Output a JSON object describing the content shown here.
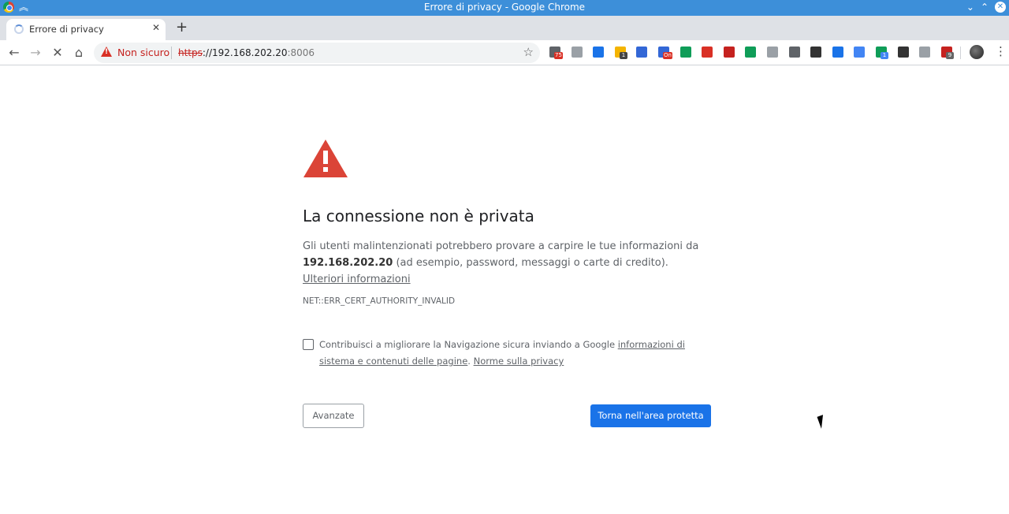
{
  "window": {
    "title": "Errore di privacy - Google Chrome"
  },
  "tabs": [
    {
      "label": "Errore di privacy"
    }
  ],
  "omnibox": {
    "security_label": "Non sicuro",
    "url_scheme": "https",
    "url_separator": "://",
    "url_host": "192.168.202.20",
    "url_port": ":8006"
  },
  "extensions": [
    {
      "name": "calendar-ext-icon",
      "color": "#5f6368",
      "badge": "75",
      "badge_color": "#d93025"
    },
    {
      "name": "globe-ext-icon",
      "color": "#9aa0a6"
    },
    {
      "name": "window-ext-icon",
      "color": "#1a73e8"
    },
    {
      "name": "note-ext-icon",
      "color": "#f4b400",
      "badge": "1",
      "badge_color": "#444444"
    },
    {
      "name": "list-ext-icon",
      "color": "#3367d6"
    },
    {
      "name": "table-ext-icon",
      "color": "#3367d6",
      "badge": "On",
      "badge_color": "#d93025"
    },
    {
      "name": "map-ext-icon",
      "color": "#0f9d58"
    },
    {
      "name": "opera-ext-icon",
      "color": "#d93025"
    },
    {
      "name": "forward-ext-icon",
      "color": "#c5221f"
    },
    {
      "name": "arrow-ext-icon",
      "color": "#0f9d58"
    },
    {
      "name": "play-ext-icon",
      "color": "#9aa0a6"
    },
    {
      "name": "s-ext-icon",
      "color": "#5f6368"
    },
    {
      "name": "camera-ext-icon",
      "color": "#333333"
    },
    {
      "name": "expand-ext-icon",
      "color": "#1a73e8"
    },
    {
      "name": "translate-ext-icon",
      "color": "#4285f4"
    },
    {
      "name": "circle-ext-icon",
      "color": "#0f9d58",
      "badge": "1",
      "badge_color": "#4285f4"
    },
    {
      "name": "scatter-ext-icon",
      "color": "#333333"
    },
    {
      "name": "radiation-ext-icon",
      "color": "#9aa0a6"
    },
    {
      "name": "r-ext-icon",
      "color": "#c5221f",
      "badge": "9",
      "badge_color": "#666666"
    }
  ],
  "page": {
    "heading": "La connessione non è privata",
    "desc_part1": "Gli utenti malintenzionati potrebbero provare a carpire le tue informazioni da ",
    "desc_host": "192.168.202.20",
    "desc_part2": " (ad esempio, password, messaggi o carte di credito). ",
    "desc_link": "Ulteriori informazioni",
    "error_code": "NET::ERR_CERT_AUTHORITY_INVALID",
    "checkbox_text": "Contribuisci a migliorare la Navigazione sicura inviando a Google ",
    "checkbox_link1": "informazioni di sistema e contenuti delle pagine",
    "checkbox_sep": ". ",
    "checkbox_link2": "Norme sulla privacy",
    "advanced_button": "Avanzate",
    "back_button": "Torna nell'area protetta"
  },
  "colors": {
    "titlebar": "#3d8fd9",
    "warning_red": "#db4437",
    "primary_blue": "#1a73e8"
  }
}
